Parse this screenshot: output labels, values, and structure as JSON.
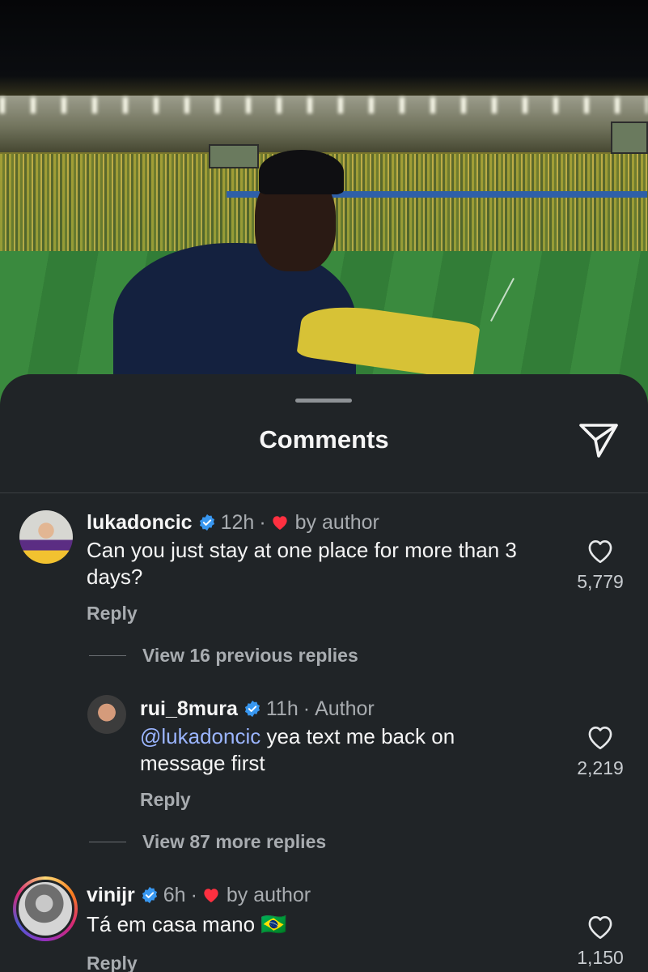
{
  "sheet": {
    "title": "Comments"
  },
  "comments": [
    {
      "username": "lukadoncic",
      "time": "12h",
      "separator": "·",
      "tag": "by author",
      "text": "Can you just stay at one place for more than 3 days?",
      "reply_label": "Reply",
      "likes": "5,779",
      "view_replies": "View 16 previous replies"
    },
    {
      "username": "rui_8mura",
      "time": "11h",
      "separator": "·",
      "tag": "Author",
      "mention": "@lukadoncic",
      "text": " yea text me back on message first",
      "reply_label": "Reply",
      "likes": "2,219",
      "view_replies": "View 87 more replies"
    },
    {
      "username": "vinijr",
      "time": "6h",
      "separator": "·",
      "tag": "by author",
      "text": "Tá em casa mano 🇧🇷",
      "reply_label": "Reply",
      "likes": "1,150"
    }
  ],
  "colors": {
    "sheet_bg": "#202427",
    "verified": "#3897f0",
    "heart_red": "#ff3040",
    "mention": "#9bb5ff"
  },
  "icons": {
    "send": "paper-plane-icon",
    "verified": "verified-badge-icon",
    "like": "heart-outline-icon",
    "author_like": "heart-filled-icon"
  }
}
